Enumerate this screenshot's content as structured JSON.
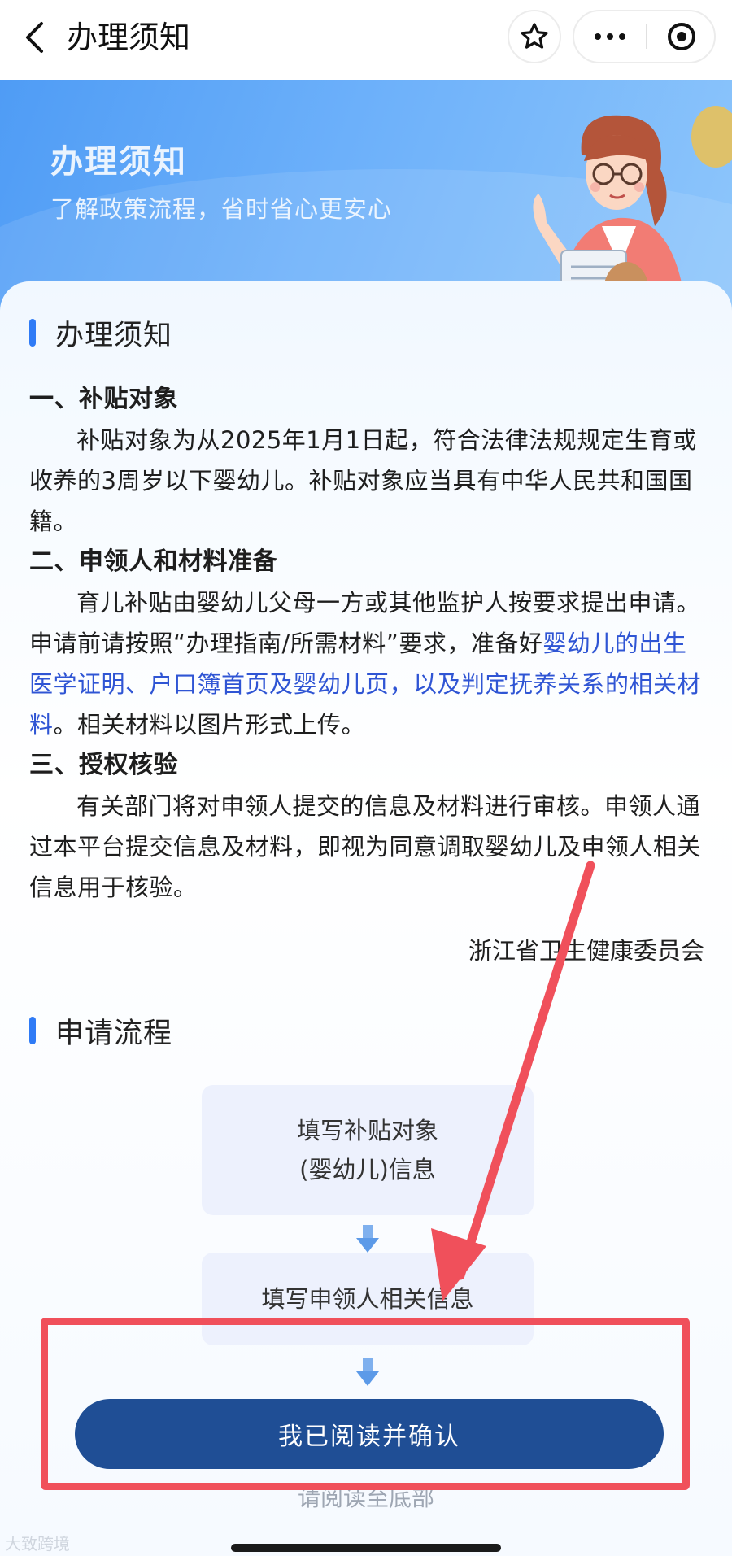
{
  "nav": {
    "title": "办理须知"
  },
  "banner": {
    "title": "办理须知",
    "subtitle": "了解政策流程，省时省心更安心"
  },
  "notice": {
    "heading": "办理须知",
    "sections": [
      {
        "title": "一、补贴对象",
        "text": "补贴对象为从2025年1月1日起，符合法律法规规定生育或收养的3周岁以下婴幼儿。补贴对象应当具有中华人民共和国国籍。"
      },
      {
        "title": "二、申领人和材料准备",
        "text_before": "育儿补贴由婴幼儿父母一方或其他监护人按要求提出申请。申请前请按照“办理指南/所需材料”要求，准备好",
        "link_text": "婴幼儿的出生医学证明、户口簿首页及婴幼儿页，以及判定抚养关系的相关材料",
        "text_after": "。相关材料以图片形式上传。"
      },
      {
        "title": "三、授权核验",
        "text": "有关部门将对申领人提交的信息及材料进行审核。申领人通过本平台提交信息及材料，即视为同意调取婴幼儿及申领人相关信息用于核验。"
      }
    ],
    "signature": "浙江省卫生健康委员会"
  },
  "flow": {
    "heading": "申请流程",
    "steps": [
      {
        "line1": "填写补贴对象",
        "line2": "(婴幼儿)信息"
      },
      {
        "line1": "填写申领人相关信息"
      }
    ]
  },
  "footer": {
    "confirm_label": "我已阅读并确认",
    "read_hint": "请阅读至底部",
    "watermark": "大致跨境"
  },
  "colors": {
    "accent": "#2f7bf6",
    "link": "#2f55d4",
    "confirm_button": "#1f4e95",
    "annotation": "#f0505b"
  },
  "icons": [
    "back-arrow-icon",
    "star-icon",
    "more-dots-icon",
    "close-target-icon",
    "down-arrow-icon"
  ]
}
